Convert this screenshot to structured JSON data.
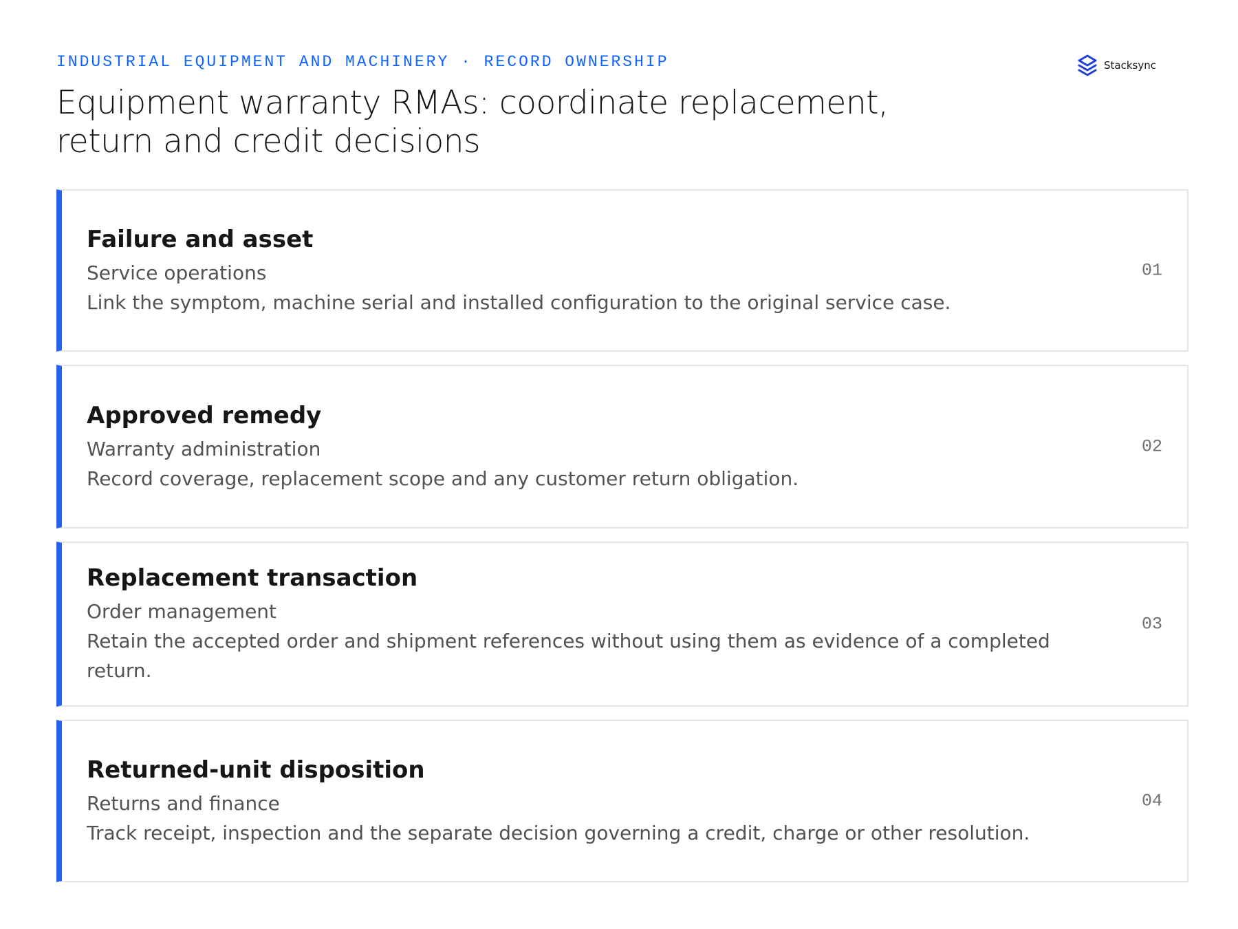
{
  "header": {
    "eyebrow": "INDUSTRIAL EQUIPMENT AND MACHINERY · RECORD OWNERSHIP",
    "title": "Equipment warranty RMAs: coordinate replacement, return and credit decisions"
  },
  "logo": {
    "text": "Stacksync",
    "icon": "stacksync-logo-icon",
    "color": "#1f3fd9"
  },
  "colors": {
    "accent": "#2563eb",
    "eyebrow": "#0f62fe"
  },
  "cards": [
    {
      "title": "Failure and asset",
      "owner": "Service operations",
      "description": "Link the symptom, machine serial and installed configuration to the original service case.",
      "number": "01"
    },
    {
      "title": "Approved remedy",
      "owner": "Warranty administration",
      "description": "Record coverage, replacement scope and any customer return obligation.",
      "number": "02"
    },
    {
      "title": "Replacement transaction",
      "owner": "Order management",
      "description": "Retain the accepted order and shipment references without using them as evidence of a completed return.",
      "number": "03"
    },
    {
      "title": "Returned-unit disposition",
      "owner": "Returns and finance",
      "description": "Track receipt, inspection and the separate decision governing a credit, charge or other resolution.",
      "number": "04"
    }
  ]
}
